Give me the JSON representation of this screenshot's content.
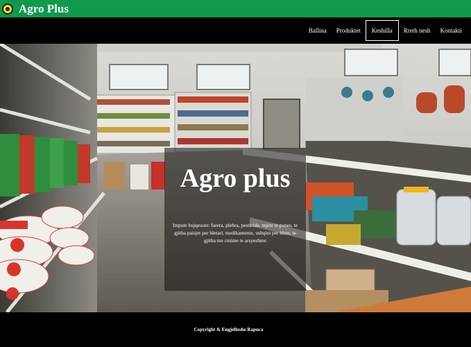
{
  "brand": {
    "name": "Agro Plus",
    "logo_icon": "circle-logo-icon",
    "bar_color": "#0f9a4e"
  },
  "nav": {
    "items": [
      {
        "label": "Ballina"
      },
      {
        "label": "Produktet"
      },
      {
        "label": "Keshilla",
        "active": true
      },
      {
        "label": "Rreth nesh"
      },
      {
        "label": "Kontakti"
      }
    ]
  },
  "hero": {
    "title": "Agro plus",
    "description": "Impute bujqesore: farera, plehra, pesticide, mjete te punes, te gjitha paisjet per bletari, medikamente, ushqim per blete, te gjitha me cmime te arsyeshme"
  },
  "footer": {
    "copyright": "Copyright & Engjellushe Rapuca"
  }
}
